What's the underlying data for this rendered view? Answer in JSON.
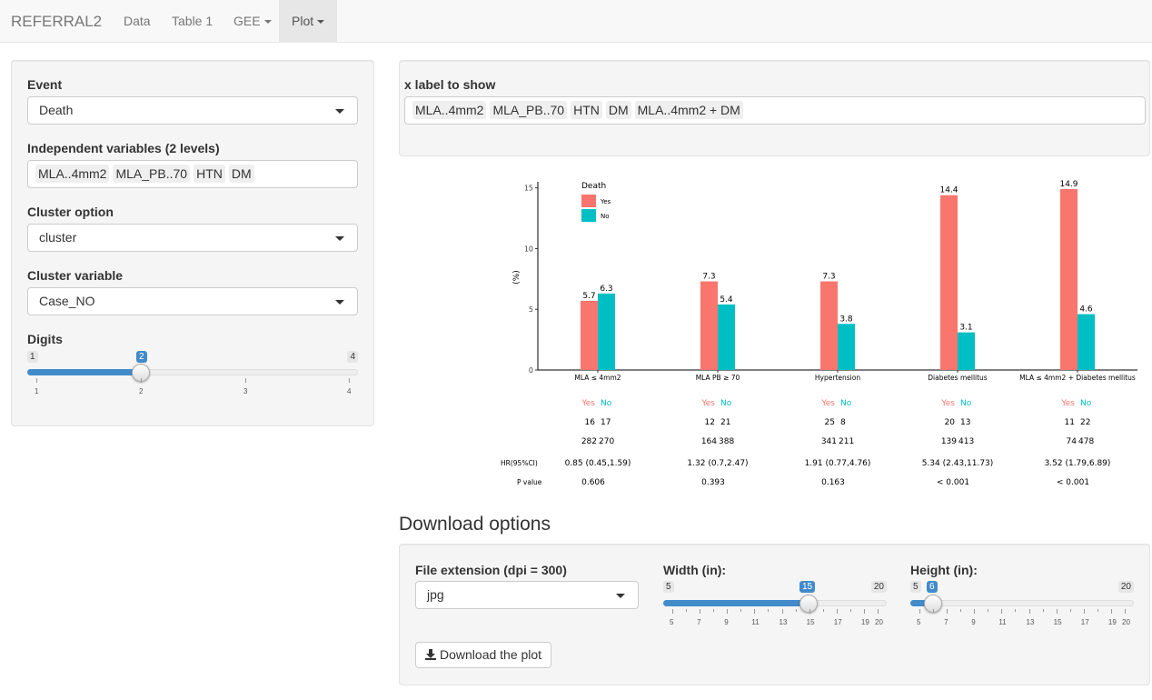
{
  "nav": {
    "brand": "REFERRAL2",
    "items": [
      {
        "label": "Data"
      },
      {
        "label": "Table 1"
      },
      {
        "label": "GEE"
      },
      {
        "label": "Plot"
      }
    ]
  },
  "sidebar": {
    "event_label": "Event",
    "event_value": "Death",
    "indep_label": "Independent variables (2 levels)",
    "indep_chips": [
      "MLA..4mm2",
      "MLA_PB..70",
      "HTN",
      "DM"
    ],
    "cluster_option_label": "Cluster option",
    "cluster_option_value": "cluster",
    "cluster_var_label": "Cluster variable",
    "cluster_var_value": "Case_NO",
    "digits_label": "Digits",
    "digits": {
      "min": "1",
      "max": "4",
      "value": "2",
      "ticks": [
        "1",
        "2",
        "3",
        "4"
      ]
    }
  },
  "xlabel_panel": {
    "label": "x label to show",
    "chips": [
      "MLA..4mm2",
      "MLA_PB..70",
      "HTN",
      "DM",
      "MLA..4mm2 + DM"
    ]
  },
  "colors": {
    "yes": "#F8766D",
    "no": "#00BFC4",
    "accent": "#428bca"
  },
  "chart_data": {
    "type": "bar",
    "categories": [
      "MLA ≤ 4mm2",
      "MLA PB ≥ 70",
      "Hypertension",
      "Diabetes mellitus",
      "MLA ≤ 4mm2 + Diabetes mellitus"
    ],
    "series": [
      {
        "name": "Yes",
        "values": [
          5.7,
          7.3,
          7.3,
          14.4,
          14.9
        ]
      },
      {
        "name": "No",
        "values": [
          6.3,
          5.4,
          3.8,
          3.1,
          4.6
        ]
      }
    ],
    "value_labels": {
      "yes": [
        "5.7",
        "7.3",
        "7.3",
        "14.4",
        "14.9"
      ],
      "no": [
        "6.3",
        "5.4",
        "3.8",
        "3.1",
        "4.6"
      ]
    },
    "ylabel": "(%)",
    "ylim": [
      0,
      15.5
    ],
    "yticks": [
      "0",
      "5",
      "10",
      "15"
    ],
    "legend_title": "Death",
    "legend": [
      "Yes",
      "No"
    ],
    "legend_position": "top-left",
    "table": {
      "header_yes": "Yes",
      "header_no": "No",
      "events": [
        [
          "16",
          "17"
        ],
        [
          "12",
          "21"
        ],
        [
          "25",
          "8"
        ],
        [
          "20",
          "13"
        ],
        [
          "11",
          "22"
        ]
      ],
      "totals": [
        [
          "282",
          "270"
        ],
        [
          "164",
          "388"
        ],
        [
          "341",
          "211"
        ],
        [
          "139",
          "413"
        ],
        [
          "74",
          "478"
        ]
      ],
      "hr_label": "HR(95%CI)",
      "hr": [
        "0.85 (0.45,1.59)",
        "1.32 (0.7,2.47)",
        "1.91 (0.77,4.76)",
        "5.34 (2.43,11.73)",
        "3.52 (1.79,6.89)"
      ],
      "p_label": "P value",
      "p": [
        "0.606",
        "0.393",
        "0.163",
        "< 0.001",
        "< 0.001"
      ]
    }
  },
  "download": {
    "title": "Download options",
    "ext_label": "File extension (dpi = 300)",
    "ext_value": "jpg",
    "width_label": "Width (in):",
    "width": {
      "min": "5",
      "max": "20",
      "value": "15",
      "ticks": [
        "5",
        "7",
        "9",
        "11",
        "13",
        "15",
        "17",
        "19",
        "20"
      ]
    },
    "height_label": "Height (in):",
    "height": {
      "min": "5",
      "max": "20",
      "value": "6",
      "ticks": [
        "5",
        "7",
        "9",
        "11",
        "13",
        "15",
        "17",
        "19",
        "20"
      ]
    },
    "button_label": "Download the plot"
  }
}
